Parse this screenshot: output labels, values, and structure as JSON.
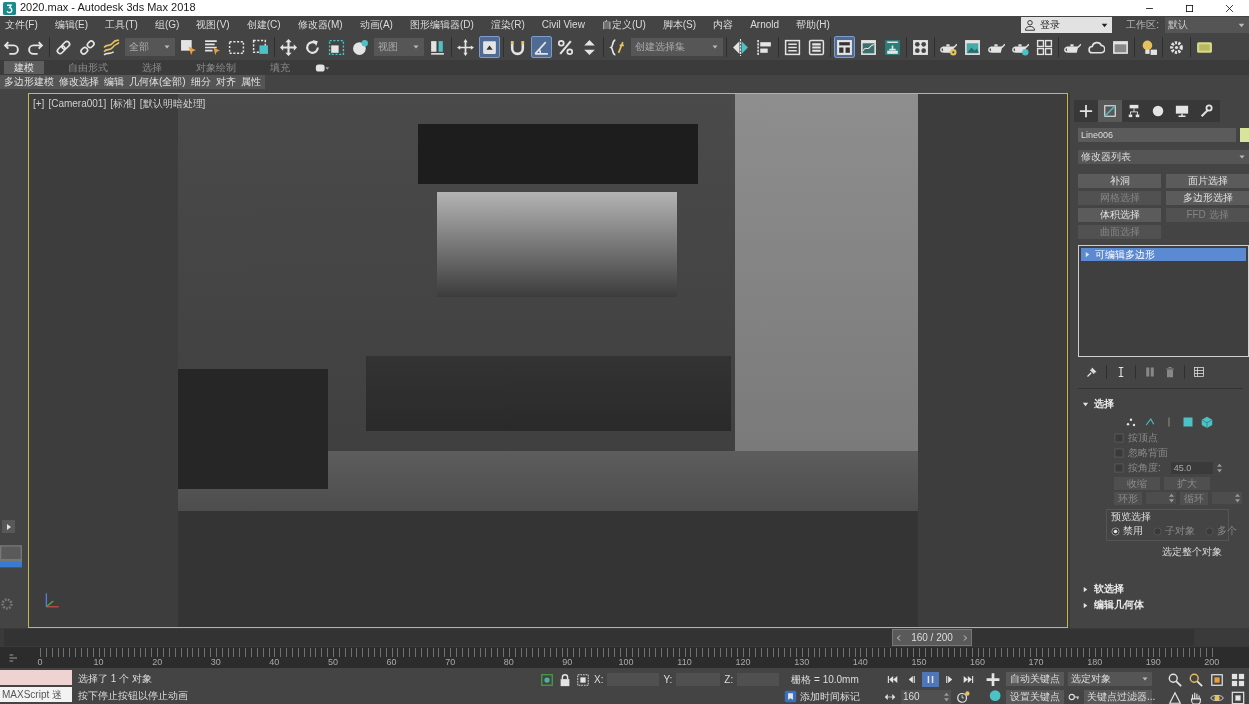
{
  "window": {
    "title": "2020.max - Autodesk 3ds Max 2018"
  },
  "menu_bar": {
    "items": [
      "文件(F)",
      "编辑(E)",
      "工具(T)",
      "组(G)",
      "视图(V)",
      "创建(C)",
      "修改器(M)",
      "动画(A)",
      "图形编辑器(D)",
      "渲染(R)",
      "Civil View",
      "自定义(U)",
      "脚本(S)",
      "内容",
      "Arnold",
      "帮助(H)"
    ],
    "login": "登录",
    "workspace_label": "工作区:",
    "workspace": "默认"
  },
  "toolbar": {
    "items": [
      {
        "kind": "button",
        "selected": false
      },
      {
        "kind": "button",
        "selected": false
      },
      {
        "kind": "separator"
      },
      {
        "kind": "button",
        "selected": false
      },
      {
        "kind": "button",
        "selected": false
      },
      {
        "kind": "button",
        "selected": false
      },
      {
        "kind": "dropdown",
        "value": "全部"
      },
      {
        "kind": "button",
        "selected": false
      },
      {
        "kind": "button",
        "selected": false
      },
      {
        "kind": "button",
        "selected": false
      },
      {
        "kind": "button",
        "selected": false
      },
      {
        "kind": "separator"
      },
      {
        "kind": "button",
        "selected": false
      },
      {
        "kind": "button",
        "selected": false
      },
      {
        "kind": "button",
        "selected": false
      },
      {
        "kind": "button",
        "selected": false
      },
      {
        "kind": "dropdown",
        "value": "视图"
      },
      {
        "kind": "button",
        "selected": false
      },
      {
        "kind": "separator"
      },
      {
        "kind": "button",
        "selected": false
      },
      {
        "kind": "button",
        "selected": true
      },
      {
        "kind": "separator"
      },
      {
        "kind": "button",
        "selected": false
      },
      {
        "kind": "button",
        "selected": true
      },
      {
        "kind": "button",
        "selected": false
      },
      {
        "kind": "button",
        "selected": false
      },
      {
        "kind": "separator"
      },
      {
        "kind": "button",
        "selected": false
      },
      {
        "kind": "dropdown",
        "value": "创建选择集"
      },
      {
        "kind": "separator"
      },
      {
        "kind": "button",
        "selected": false
      },
      {
        "kind": "button",
        "selected": false
      },
      {
        "kind": "separator"
      },
      {
        "kind": "button",
        "selected": false
      },
      {
        "kind": "button",
        "selected": false
      },
      {
        "kind": "separator"
      },
      {
        "kind": "button",
        "selected": true
      },
      {
        "kind": "button",
        "selected": false
      },
      {
        "kind": "button",
        "selected": false
      },
      {
        "kind": "separator"
      },
      {
        "kind": "button",
        "selected": false
      },
      {
        "kind": "separator"
      },
      {
        "kind": "button",
        "selected": false
      },
      {
        "kind": "button",
        "selected": false
      },
      {
        "kind": "button",
        "selected": false
      },
      {
        "kind": "button",
        "selected": false
      },
      {
        "kind": "button",
        "selected": false
      },
      {
        "kind": "separator"
      },
      {
        "kind": "button",
        "selected": false
      },
      {
        "kind": "button",
        "selected": false
      },
      {
        "kind": "button",
        "selected": false
      },
      {
        "kind": "separator"
      },
      {
        "kind": "button",
        "selected": false
      },
      {
        "kind": "separator"
      },
      {
        "kind": "button",
        "selected": false
      },
      {
        "kind": "separator"
      },
      {
        "kind": "button",
        "selected": false
      }
    ]
  },
  "ribbon": {
    "tabs": [
      {
        "label": "建模",
        "selected": true
      },
      {
        "label": "自由形式",
        "selected": false
      },
      {
        "label": "选择",
        "selected": false
      },
      {
        "label": "对象绘制",
        "selected": false
      },
      {
        "label": "填充",
        "selected": false
      }
    ],
    "panels": [
      "多边形建模",
      "修改选择",
      "编辑",
      "几何体(全部)",
      "细分",
      "对齐",
      "属性"
    ]
  },
  "viewport": {
    "active": true,
    "menus": [
      "[+]",
      "[Camera001]",
      "[标准]",
      "[默认明暗处理]"
    ]
  },
  "command_panel": {
    "tabs": [
      {
        "selected": false
      },
      {
        "selected": true
      },
      {
        "selected": false
      },
      {
        "selected": false
      },
      {
        "selected": false
      },
      {
        "selected": false
      }
    ],
    "object_name": "Line006",
    "modifier_list": "修改器列表",
    "modifier_buttons": [
      {
        "label": "补洞",
        "disabled": false
      },
      {
        "label": "面片选择",
        "disabled": false
      },
      {
        "label": "网格选择",
        "disabled": true
      },
      {
        "label": "多边形选择",
        "disabled": false
      },
      {
        "label": "体积选择",
        "disabled": false
      },
      {
        "label": "FFD 选择",
        "disabled": true
      },
      {
        "label": "曲面选择",
        "disabled": true
      }
    ],
    "stack": [
      {
        "label": "可编辑多边形",
        "selected": true
      }
    ],
    "selection": {
      "title": "选择",
      "expanded": true,
      "levels": [
        {
          "selected": false
        },
        {
          "selected": false
        },
        {
          "selected": false
        },
        {
          "selected": false
        },
        {
          "selected": false
        }
      ],
      "options": [
        {
          "label": "按顶点",
          "checked": false,
          "disabled": true
        },
        {
          "label": "忽略背面",
          "checked": false,
          "disabled": true
        }
      ],
      "by_angle": {
        "label": "按角度:",
        "value": "45.0",
        "checked": false,
        "disabled": true
      },
      "buttons": [
        {
          "label": "收缩",
          "disabled": true
        },
        {
          "label": "扩大",
          "disabled": true
        }
      ],
      "spinners": [
        {
          "label": "环形",
          "disabled": true
        },
        {
          "label": "循环",
          "disabled": true
        }
      ],
      "preview": {
        "title": "预览选择",
        "options": [
          {
            "label": "禁用",
            "selected": true,
            "disabled": false
          },
          {
            "label": "子对象",
            "selected": false,
            "disabled": true
          },
          {
            "label": "多个",
            "selected": false,
            "disabled": true
          }
        ]
      },
      "footer": "选定整个对象"
    },
    "rollouts": [
      {
        "title": "软选择",
        "expanded": false
      },
      {
        "title": "编辑几何体",
        "expanded": false
      }
    ]
  },
  "time_slider": {
    "label": "160 / 200",
    "level": 0.8
  },
  "track_bar": {
    "labels": [
      "0",
      "10",
      "20",
      "30",
      "40",
      "50",
      "60",
      "70",
      "80",
      "90",
      "100",
      "110",
      "120",
      "130",
      "140",
      "150",
      "160",
      "170",
      "180",
      "190",
      "200"
    ]
  },
  "status_bar": {
    "mini_listener": "MAXScript 迷",
    "prompt": "选择了 1 个 对象",
    "hint": "按下停止按钮以停止动画",
    "coords": [
      "X:",
      "Y:",
      "Z:"
    ],
    "grid": "栅格 = 10.0mm",
    "time_tag": "添加时间标记",
    "playback": [
      {
        "selected": false
      },
      {
        "selected": false
      },
      {
        "selected": true
      },
      {
        "selected": false
      },
      {
        "selected": false
      }
    ],
    "frame": "160",
    "auto_key": "自动关键点",
    "key_set": "选定对象",
    "set_key": "设置关键点",
    "key_filters": "关键点过滤器..."
  }
}
